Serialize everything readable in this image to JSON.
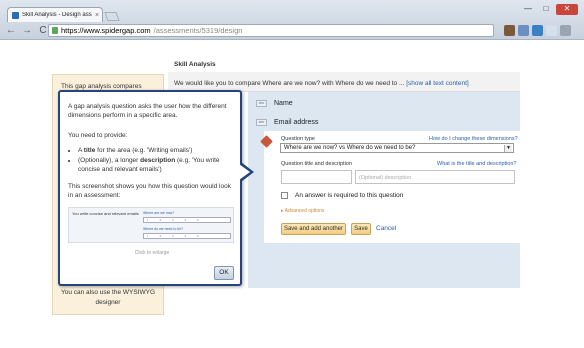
{
  "browser": {
    "tab_title": "Skill Analysis - Design ass",
    "tab_close": "×",
    "window_controls": [
      "—",
      "□",
      "✕"
    ],
    "url_host": "https://www.spidergap.com",
    "url_path": "/assessments/5319/design",
    "nav": {
      "back": "←",
      "forward": "→",
      "reload": "C"
    }
  },
  "help_panel": {
    "intro": "This gap analysis compares",
    "bottom_line1": "You can also use the WYSIWYG",
    "bottom_line2": "designer"
  },
  "popup": {
    "p1": "A gap analysis question asks the user how the different dimensions perform in a specific area.",
    "p2": "You need to provide:",
    "bullet1_pre": "A ",
    "bullet1_bold": "title",
    "bullet1_post": " for the area (e.g. 'Writing emails')",
    "bullet2_pre": "(Optionally), a longer ",
    "bullet2_bold": "description",
    "bullet2_post": " (e.g. 'You write concise and relevant emails')",
    "p3": "This screenshot shows you how this question would look in an assessment:",
    "thumb_label": "You write concise and relevant emails",
    "thumb_q1": "Where are we now?",
    "thumb_q2": "Where do we need to be?",
    "thumb_scale": "1 2 3 4 5",
    "click_enlarge": "Click to enlarge",
    "ok": "OK"
  },
  "main": {
    "title": "Skill Analysis",
    "compare_text": "We would like you to compare Where are we now? with Where do we need to ...",
    "show_all": "[show all text content]",
    "fields": [
      {
        "icon": "abc",
        "label": "Name"
      },
      {
        "icon": "abc",
        "label": "Email address"
      }
    ],
    "question_type_label": "Question type",
    "dimensions_link": "How do I change these dimensions?",
    "question_type_value": "Where are we now? vs Where do we need to be?",
    "title_desc_label": "Question title and description",
    "title_desc_link": "What is the title and description?",
    "title_placeholder": "",
    "desc_placeholder": "(Optional) description",
    "required_label": "An answer is required to this question",
    "advanced": "▸ Advanced options",
    "save_add": "Save and add another",
    "save": "Save",
    "cancel": "Cancel"
  }
}
